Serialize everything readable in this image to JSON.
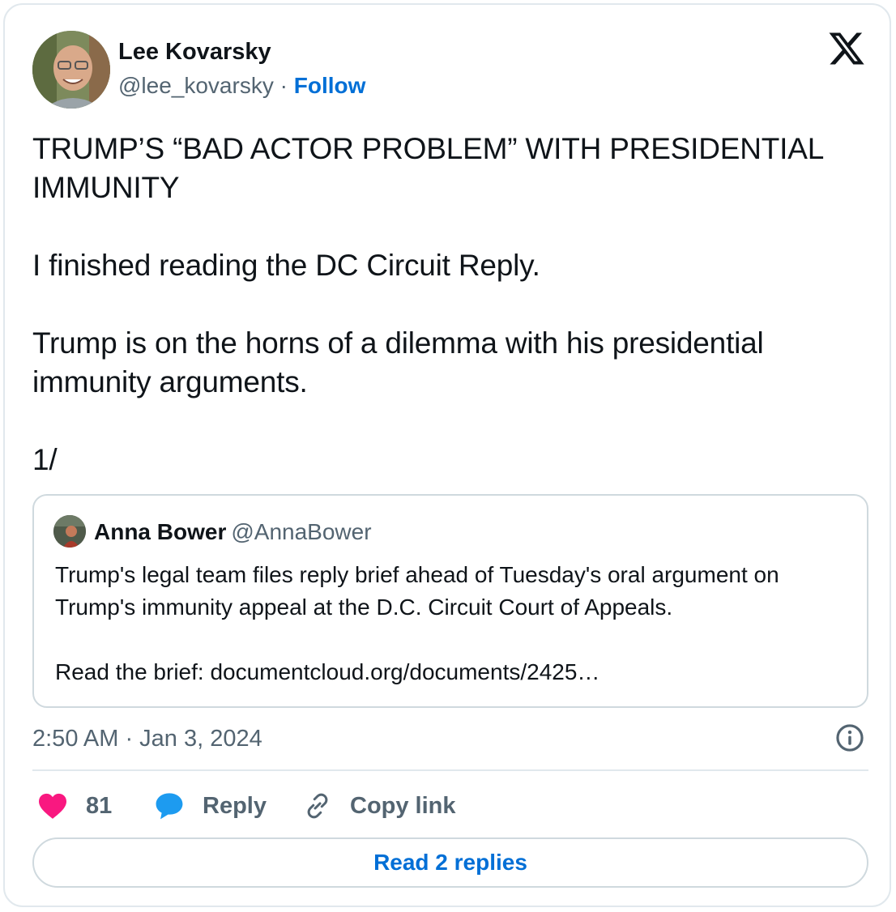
{
  "author": {
    "name": "Lee Kovarsky",
    "handle": "@lee_kovarsky",
    "separator": "·",
    "follow_label": "Follow",
    "avatar_icon": "profile-photo"
  },
  "platform_icon": "x-logo-icon",
  "tweet": {
    "text": "TRUMP’S “BAD ACTOR PROBLEM” WITH PRESIDENTIAL IMMUNITY\n\nI finished reading the DC Circuit Reply.\n\nTrump is on the horns of a dilemma with his presidential immunity arguments.\n\n1/"
  },
  "quoted_tweet": {
    "name": "Anna Bower",
    "handle": "@AnnaBower",
    "text": "Trump's legal team files reply brief ahead of Tuesday's oral argument on Trump's immunity appeal at the D.C. Circuit Court of Appeals.\n\nRead the brief: documentcloud.org/documents/2425…"
  },
  "timestamp": "2:50 AM · Jan 3, 2024",
  "actions": {
    "like_count": "81",
    "reply_label": "Reply",
    "copy_label": "Copy link"
  },
  "read_replies_label": "Read 2 replies",
  "colors": {
    "accent": "#006fd6",
    "like": "#f91880",
    "reply_icon": "#1d9bf0",
    "secondary_text": "#536471",
    "border": "#cfd9de"
  }
}
